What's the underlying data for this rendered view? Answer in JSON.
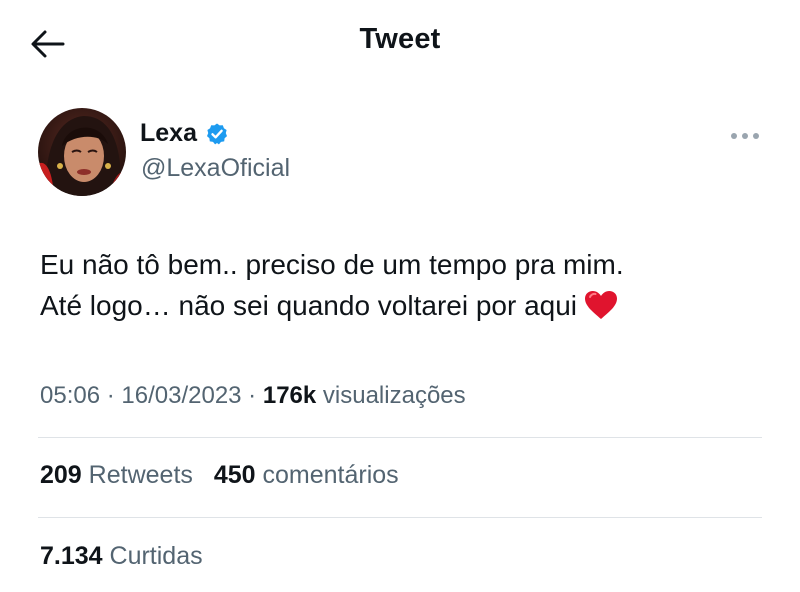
{
  "header": {
    "title": "Tweet",
    "back_icon": "arrow-left-icon"
  },
  "author": {
    "display_name": "Lexa",
    "handle": "@LexaOficial",
    "verified_icon": "verified-badge-icon",
    "verified_color": "#1d9bf0"
  },
  "tweet": {
    "lines": [
      "Eu não tô bem.. preciso de um tempo pra mim.",
      "Até logo… não sei quando voltarei por aqui"
    ],
    "emoji_icon": "red-heart-icon"
  },
  "meta": {
    "time": "05:06",
    "separator": " · ",
    "date": "16/03/2023",
    "views_count": "176k",
    "views_label": "visualizações"
  },
  "stats": {
    "retweets_count": "209",
    "retweets_label": "Retweets",
    "comments_count": "450",
    "comments_label": "comentários",
    "likes_count": "7.134",
    "likes_label": "Curtidas"
  },
  "colors": {
    "text": "#0f1419",
    "secondary": "#536471",
    "divider": "#dfe3e7",
    "heart": "#e0142e"
  }
}
